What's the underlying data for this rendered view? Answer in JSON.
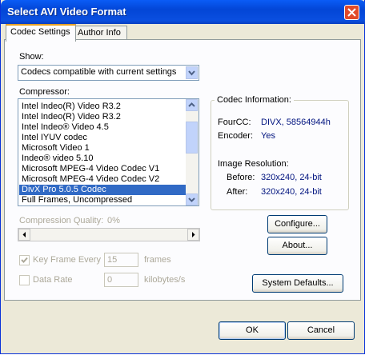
{
  "window": {
    "title": "Select AVI Video Format"
  },
  "tabs": [
    "Codec Settings",
    "Author Info"
  ],
  "show": {
    "label": "Show:",
    "value": "Codecs compatible with current settings"
  },
  "compressor": {
    "label": "Compressor:",
    "items": [
      "Intel Indeo(R) Video R3.2",
      "Intel Indeo(R) Video R3.2",
      "Intel Indeo® Video 4.5",
      "Intel IYUV codec",
      "Microsoft Video 1",
      "Indeo® video 5.10",
      "Microsoft MPEG-4 Video Codec V1",
      "Microsoft MPEG-4 Video Codec V2",
      "DivX Pro 5.0.5 Codec",
      "Full Frames, Uncompressed"
    ],
    "selected_index": 8
  },
  "codec_info": {
    "title": "Codec Information:",
    "fourcc_label": "FourCC:",
    "fourcc_value": "DIVX,  58564944h",
    "encoder_label": "Encoder:",
    "encoder_value": "Yes",
    "image_res_label": "Image Resolution:",
    "before_label": "Before:",
    "before_value": "320x240, 24-bit",
    "after_label": "After:",
    "after_value": "320x240, 24-bit"
  },
  "quality": {
    "label": "Compression Quality:",
    "value": "0%"
  },
  "keyframe": {
    "label": "Key Frame Every",
    "value": "15",
    "unit": "frames",
    "checked": true
  },
  "datarate": {
    "label": "Data Rate",
    "value": "0",
    "unit": "kilobytes/s",
    "checked": false
  },
  "buttons": {
    "configure": "Configure...",
    "about": "About...",
    "system_defaults": "System Defaults...",
    "ok": "OK",
    "cancel": "Cancel"
  }
}
